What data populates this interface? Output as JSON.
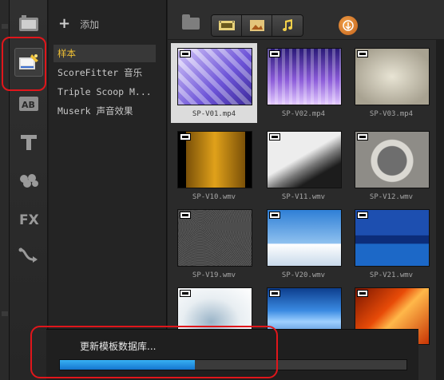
{
  "library": {
    "add_label": "添加",
    "items": [
      {
        "label": "样本",
        "selected": true
      },
      {
        "label": "ScoreFitter 音乐",
        "selected": false
      },
      {
        "label": "Triple Scoop M...",
        "selected": false
      },
      {
        "label": "Muserk 声音效果",
        "selected": false
      }
    ]
  },
  "sidebar": {
    "icons": [
      "media-library-icon",
      "instant-project-icon",
      "transition-icon",
      "title-icon",
      "graphic-icon",
      "filter-icon",
      "path-icon"
    ],
    "active": "instant-project-icon"
  },
  "toolbar": {
    "icons": [
      "folder-icon",
      "video-filter-icon",
      "photo-filter-icon",
      "audio-filter-icon",
      "sort-icon"
    ]
  },
  "media": {
    "items": [
      {
        "name": "SP-V01.mp4",
        "selected": true
      },
      {
        "name": "SP-V02.mp4",
        "selected": false
      },
      {
        "name": "SP-V03.mp4",
        "selected": false
      },
      {
        "name": "SP-V10.wmv",
        "selected": false
      },
      {
        "name": "SP-V11.wmv",
        "selected": false
      },
      {
        "name": "SP-V12.wmv",
        "selected": false
      },
      {
        "name": "SP-V19.wmv",
        "selected": false
      },
      {
        "name": "SP-V20.wmv",
        "selected": false
      },
      {
        "name": "SP-V21.wmv",
        "selected": false
      },
      {
        "name": "",
        "selected": false
      },
      {
        "name": "",
        "selected": false
      },
      {
        "name": "",
        "selected": false
      }
    ]
  },
  "progress": {
    "message": "更新模板数据库...",
    "fraction": 0.39
  },
  "colors": {
    "accent_selected_text": "#f0c034",
    "progress_fill": "#1e8fe0",
    "highlight": "#e0161b"
  }
}
